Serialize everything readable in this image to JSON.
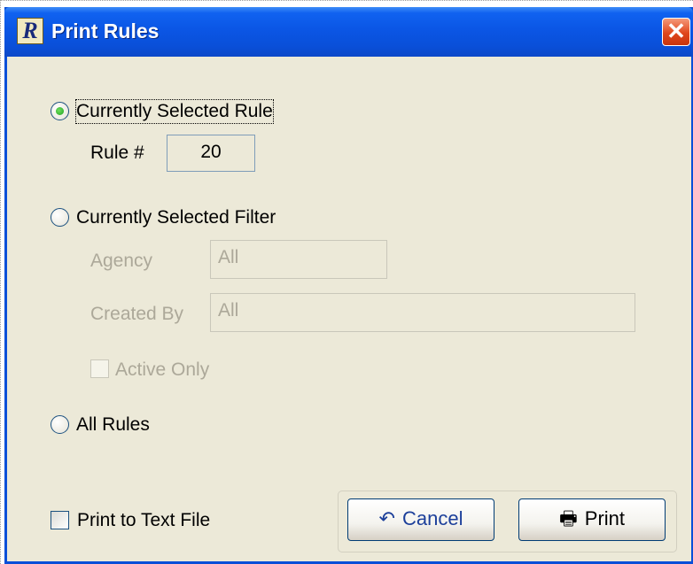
{
  "window": {
    "title": "Print Rules",
    "app_icon_letter": "R",
    "close_symbol": "✕"
  },
  "options": {
    "selected_rule": {
      "label": "Currently Selected Rule",
      "checked": true
    },
    "rule_number": {
      "label": "Rule #",
      "value": "20"
    },
    "selected_filter": {
      "label": "Currently Selected Filter",
      "checked": false
    },
    "agency": {
      "label": "Agency",
      "value": "All"
    },
    "created_by": {
      "label": "Created By",
      "value": "All"
    },
    "active_only": {
      "label": "Active Only",
      "checked": false
    },
    "all_rules": {
      "label": "All Rules",
      "checked": false
    }
  },
  "print_to_text": {
    "label": "Print to Text File",
    "checked": false
  },
  "buttons": {
    "cancel": {
      "label": "Cancel",
      "icon": "undo-arrow-icon",
      "glyph": "↶"
    },
    "print": {
      "label": "Print",
      "icon": "printer-icon",
      "glyph": "🖶"
    }
  }
}
